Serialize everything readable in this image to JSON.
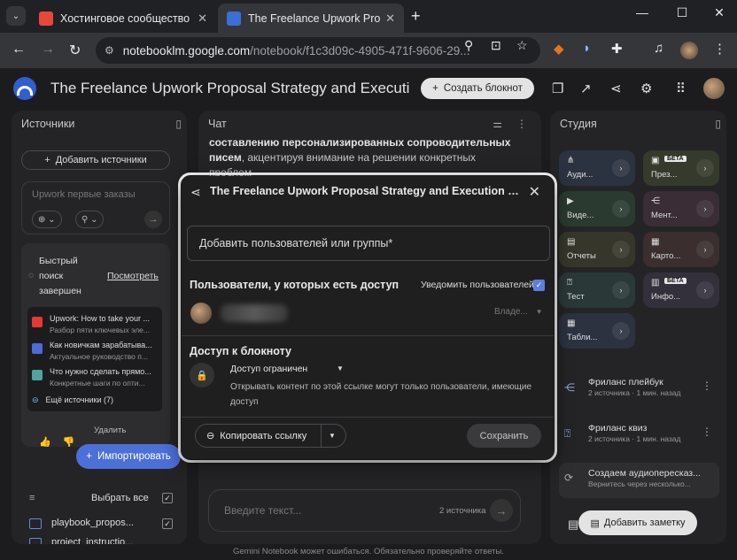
{
  "browser": {
    "tabs": [
      {
        "title": "Хостинговое сообщество «Tim",
        "close": "✕",
        "favicon_color": "#e9463c"
      },
      {
        "title": "The Freelance Upwork Proposal",
        "close": "✕",
        "favicon_color": "#3b6fd6"
      }
    ],
    "tab_list_glyph": "⌄",
    "new_tab": "+",
    "window_controls": {
      "min": "—",
      "max": "☐",
      "close": "✕"
    },
    "nav": {
      "back": "←",
      "forward": "→",
      "reload": "↻"
    },
    "url_host": "notebooklm.google.com",
    "url_path": "/notebook/f1c3d09c-4905-471f-9606-29..."
  },
  "app": {
    "title": "The Freelance Upwork Proposal Strategy and Execution Pl",
    "create_button": "Создать блокнот"
  },
  "sources": {
    "title": "Источники",
    "add_button": "Добавить источники",
    "search_placeholder": "Upwork первые заказы",
    "quick_search_status": "Быстрый поиск завершен",
    "quick_search_view": "Посмотреть",
    "results": [
      {
        "title": "Upwork: How to take your ...",
        "subtitle": "Разбор пяти ключевых эле...",
        "icon_color": "#e53935"
      },
      {
        "title": "Как новичкам зарабатыва...",
        "subtitle": "Актуальное руководство п...",
        "icon_color": "#4a6cd4"
      },
      {
        "title": "Что нужно сделать прямо...",
        "subtitle": "Конкретные шаги по опти...",
        "icon_color": "#4fa3a0"
      }
    ],
    "more_sources": "Ещё источники (7)",
    "delete": "Удалить",
    "import_button": "Импортировать",
    "select_all": "Выбрать все",
    "files": [
      "playbook_propos...",
      "project_instructio..."
    ]
  },
  "chat": {
    "title": "Чат",
    "text_bold": "составлению персонализированных сопроводительных писем",
    "text_rest": ", акцентируя внимание на решении конкретных проблем",
    "input_placeholder": "Введите текст...",
    "source_count": "2 источника"
  },
  "studio": {
    "title": "Студия",
    "tiles": [
      {
        "label": "Ауди...",
        "bg": "#2c3340",
        "beta": ""
      },
      {
        "label": "През...",
        "bg": "#363a2c",
        "beta": "БЕТА"
      },
      {
        "label": "Виде...",
        "bg": "#2a3a30",
        "beta": ""
      },
      {
        "label": "Мент...",
        "bg": "#3a2d36",
        "beta": ""
      },
      {
        "label": "Отчеты",
        "bg": "#37362a",
        "beta": ""
      },
      {
        "label": "Карто...",
        "bg": "#3a2e2e",
        "beta": ""
      },
      {
        "label": "Тест",
        "bg": "#2a3838",
        "beta": ""
      },
      {
        "label": "Инфо...",
        "bg": "#33303c",
        "beta": "БЕТА"
      },
      {
        "label": "Табли...",
        "bg": "#2c3240",
        "beta": ""
      }
    ],
    "notes": [
      {
        "title": "Фриланс плейбук",
        "meta": "2 источника · 1 мин. назад"
      },
      {
        "title": "Фриланс квиз",
        "meta": "2 источника · 1 мин. назад"
      },
      {
        "title": "Создаем аудиопересказ...",
        "meta": "Вернитесь через несколько..."
      }
    ],
    "add_note": "Добавить заметку"
  },
  "dialog": {
    "title": "The Freelance Upwork Proposal Strategy and Execution Playboo...",
    "input_placeholder": "Добавить пользователей или группы*",
    "users_heading": "Пользователи, у которых есть доступ",
    "notify": "Уведомить пользователей",
    "role": "Владе...",
    "access_heading": "Доступ к блокноту",
    "access_value": "Доступ ограничен",
    "access_desc": "Открывать контент по этой ссылке могут только пользователи, имеющие доступ",
    "copy_link": "Копировать ссылку",
    "save": "Сохранить"
  },
  "footer": "Gemini Notebook может ошибаться. Обязательно проверяйте ответы."
}
